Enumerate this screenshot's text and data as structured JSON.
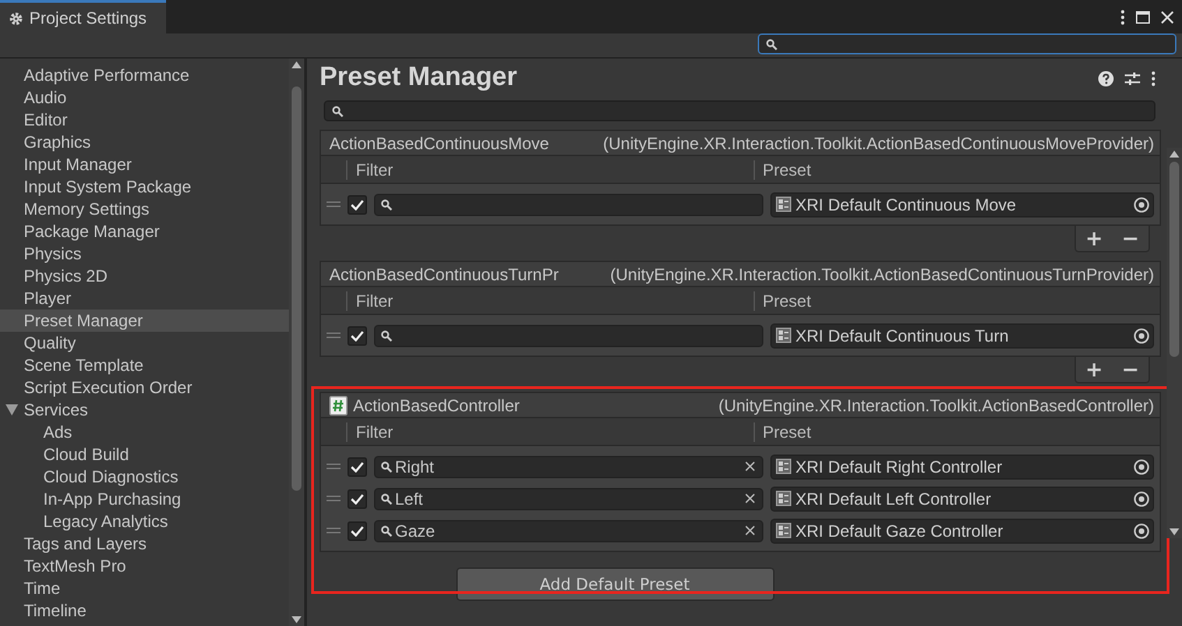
{
  "window": {
    "tab": "Project Settings"
  },
  "sidebar": {
    "items": [
      {
        "label": "Adaptive Performance",
        "selected": false
      },
      {
        "label": "Audio",
        "selected": false
      },
      {
        "label": "Editor",
        "selected": false
      },
      {
        "label": "Graphics",
        "selected": false
      },
      {
        "label": "Input Manager",
        "selected": false
      },
      {
        "label": "Input System Package",
        "selected": false
      },
      {
        "label": "Memory Settings",
        "selected": false
      },
      {
        "label": "Package Manager",
        "selected": false
      },
      {
        "label": "Physics",
        "selected": false
      },
      {
        "label": "Physics 2D",
        "selected": false
      },
      {
        "label": "Player",
        "selected": false
      },
      {
        "label": "Preset Manager",
        "selected": true
      },
      {
        "label": "Quality",
        "selected": false
      },
      {
        "label": "Scene Template",
        "selected": false
      },
      {
        "label": "Script Execution Order",
        "selected": false
      },
      {
        "label": "Services",
        "selected": false,
        "expanded": true,
        "children": [
          {
            "label": "Ads",
            "selected": false
          },
          {
            "label": "Cloud Build",
            "selected": false
          },
          {
            "label": "Cloud Diagnostics",
            "selected": false
          },
          {
            "label": "In-App Purchasing",
            "selected": false
          },
          {
            "label": "Legacy Analytics",
            "selected": false
          }
        ]
      },
      {
        "label": "Tags and Layers",
        "selected": false
      },
      {
        "label": "TextMesh Pro",
        "selected": false
      },
      {
        "label": "Time",
        "selected": false
      },
      {
        "label": "Timeline",
        "selected": false
      }
    ]
  },
  "panel": {
    "title": "Preset Manager",
    "sections": [
      {
        "name": "ActionBasedContinuousMove",
        "type": "(UnityEngine.XR.Interaction.Toolkit.ActionBasedContinuousMoveProvider)",
        "script_icon": false,
        "highlighted": false,
        "columns": [
          "Filter",
          "Preset"
        ],
        "rows": [
          {
            "checked": true,
            "preset": "XRI Default Continuous Move"
          }
        ],
        "buttons": [
          "+",
          "−"
        ]
      },
      {
        "name": "ActionBasedContinuousTurnPr",
        "type": "(UnityEngine.XR.Interaction.Toolkit.ActionBasedContinuousTurnProvider)",
        "script_icon": false,
        "highlighted": false,
        "columns": [
          "Filter",
          "Preset"
        ],
        "rows": [
          {
            "checked": true,
            "preset": "XRI Default Continuous Turn"
          }
        ],
        "buttons": [
          "+",
          "−"
        ]
      },
      {
        "name": "ActionBasedController",
        "type": "(UnityEngine.XR.Interaction.Toolkit.ActionBasedController)",
        "script_icon": true,
        "highlighted": true,
        "columns": [
          "Filter",
          "Preset"
        ],
        "rows": [
          {
            "checked": true,
            "filter": "Right",
            "preset": "XRI Default Right Controller"
          },
          {
            "checked": true,
            "filter": "Left",
            "preset": "XRI Default Left Controller"
          },
          {
            "checked": true,
            "filter": "Gaze",
            "preset": "XRI Default Gaze Controller"
          }
        ]
      }
    ],
    "add_button": "Add Default Preset"
  }
}
